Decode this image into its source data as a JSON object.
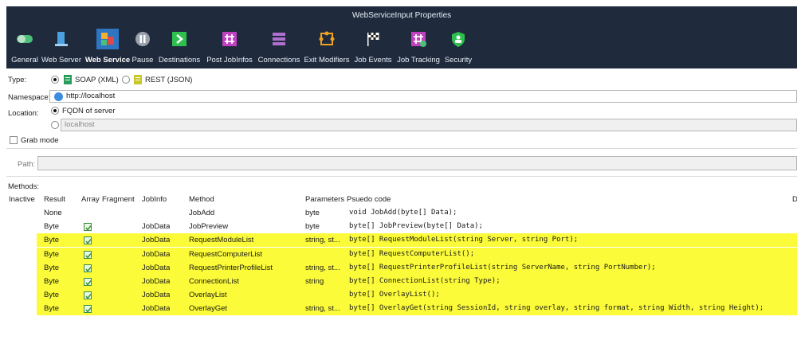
{
  "window": {
    "title": "WebServiceInput Properties"
  },
  "toolbar": {
    "items": [
      {
        "label": "General",
        "icon": "toggle-icon",
        "color": "#4cc07a"
      },
      {
        "label": "Web Server",
        "icon": "server-icon",
        "color": "#4aa0e0"
      },
      {
        "label": "Web Service",
        "icon": "web-service-icon",
        "color": "#f0b030",
        "active": true
      },
      {
        "label": "Pause",
        "icon": "pause-icon",
        "color": "#9aa3ad"
      },
      {
        "label": "Destinations",
        "icon": "destinations-icon",
        "color": "#2ec04e"
      },
      {
        "label": "Post JobInfos",
        "icon": "post-jobinfos-icon",
        "color": "#c040c0"
      },
      {
        "label": "Connections",
        "icon": "connections-icon",
        "color": "#b070d0"
      },
      {
        "label": "Exit Modifiers",
        "icon": "exit-modifiers-icon",
        "color": "#f0a020"
      },
      {
        "label": "Job Events",
        "icon": "flag-icon",
        "color": "#ffffff"
      },
      {
        "label": "Job Tracking",
        "icon": "job-tracking-icon",
        "color": "#c040c0"
      },
      {
        "label": "Security",
        "icon": "shield-icon",
        "color": "#2ec04e"
      }
    ]
  },
  "form": {
    "type_label": "Type:",
    "soap_label": "SOAP (XML)",
    "rest_label": "REST (JSON)",
    "namespace_label": "Namespace:",
    "namespace_value": "http://localhost",
    "location_label": "Location:",
    "fqdn_label": "FQDN of server",
    "localhost_value": "localhost",
    "grab_mode_label": "Grab mode",
    "path_label": "Path:",
    "path_value": "",
    "methods_label": "Methods:"
  },
  "methods": {
    "columns": [
      "Inactive",
      "Result",
      "Array",
      "Fragment",
      "JobInfo",
      "Method",
      "Parameters",
      "Psuedo code",
      "D"
    ],
    "rows": [
      {
        "result": "None",
        "array": false,
        "jobinfo": "",
        "method": "JobAdd",
        "params": "byte",
        "code": "void JobAdd(byte[] Data);",
        "highlight": false
      },
      {
        "result": "Byte",
        "array": true,
        "jobinfo": "JobData",
        "method": "JobPreview",
        "params": "byte",
        "code": "byte[] JobPreview(byte[] Data);",
        "highlight": false
      },
      {
        "result": "Byte",
        "array": true,
        "jobinfo": "JobData",
        "method": "RequestModuleList",
        "params": "string, st...",
        "code": "byte[] RequestModuleList(string Server, string Port);",
        "highlight": true
      },
      {
        "result": "Byte",
        "array": true,
        "jobinfo": "JobData",
        "method": "RequestComputerList",
        "params": "",
        "code": "byte[] RequestComputerList();",
        "highlight": true
      },
      {
        "result": "Byte",
        "array": true,
        "jobinfo": "JobData",
        "method": "RequestPrinterProfileList",
        "params": "string, st...",
        "code": "byte[] RequestPrinterProfileList(string ServerName, string PortNumber);",
        "highlight": true
      },
      {
        "result": "Byte",
        "array": true,
        "jobinfo": "JobData",
        "method": "ConnectionList",
        "params": "string",
        "code": "byte[] ConnectionList(string Type);",
        "highlight": true
      },
      {
        "result": "Byte",
        "array": true,
        "jobinfo": "JobData",
        "method": "OverlayList",
        "params": "",
        "code": "byte[] OverlayList();",
        "highlight": true
      },
      {
        "result": "Byte",
        "array": true,
        "jobinfo": "JobData",
        "method": "OverlayGet",
        "params": "string, st...",
        "code": "byte[] OverlayGet(string SessionId, string overlay, string format, string Width, string Height);",
        "highlight": true
      }
    ]
  },
  "colors": {
    "header_bg": "#1f2b3d",
    "active_tab": "#2f76c2",
    "highlight": "#fbfb3a",
    "check_green": "#3a8f3a"
  }
}
